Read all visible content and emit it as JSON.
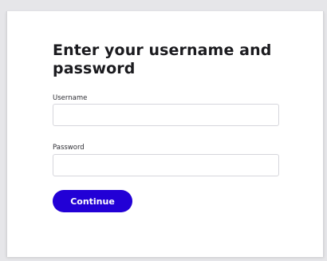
{
  "login": {
    "heading": "Enter your username and password",
    "username_label": "Username",
    "username_value": "",
    "password_label": "Password",
    "password_value": "",
    "continue_label": "Continue"
  },
  "colors": {
    "accent": "#2200d6",
    "background": "#e6e6e9",
    "card": "#ffffff"
  }
}
